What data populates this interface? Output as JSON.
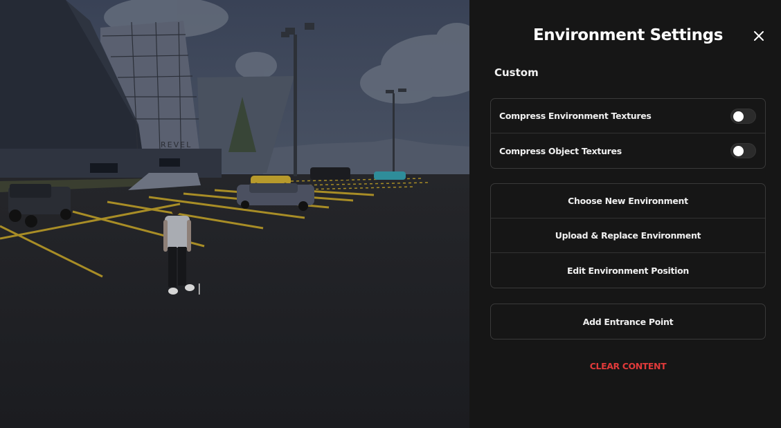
{
  "scene": {
    "building_sign": "REVEL",
    "colors": {
      "sky": "#3d4658",
      "asphalt": "#1f2024",
      "parking_line": "#b89a2a"
    }
  },
  "panel": {
    "title": "Environment Settings",
    "close_icon": "close-icon",
    "section_label": "Custom",
    "toggles": [
      {
        "label": "Compress Environment Textures",
        "enabled": false
      },
      {
        "label": "Compress Object Textures",
        "enabled": false
      }
    ],
    "environment_actions": [
      {
        "label": "Choose New Environment"
      },
      {
        "label": "Upload & Replace Environment"
      },
      {
        "label": "Edit Environment Position"
      }
    ],
    "entrance_action": {
      "label": "Add Entrance Point"
    },
    "clear_label": "CLEAR CONTENT",
    "colors": {
      "background": "#161616",
      "border": "#3a3a3a",
      "danger": "#e03a3a"
    }
  }
}
